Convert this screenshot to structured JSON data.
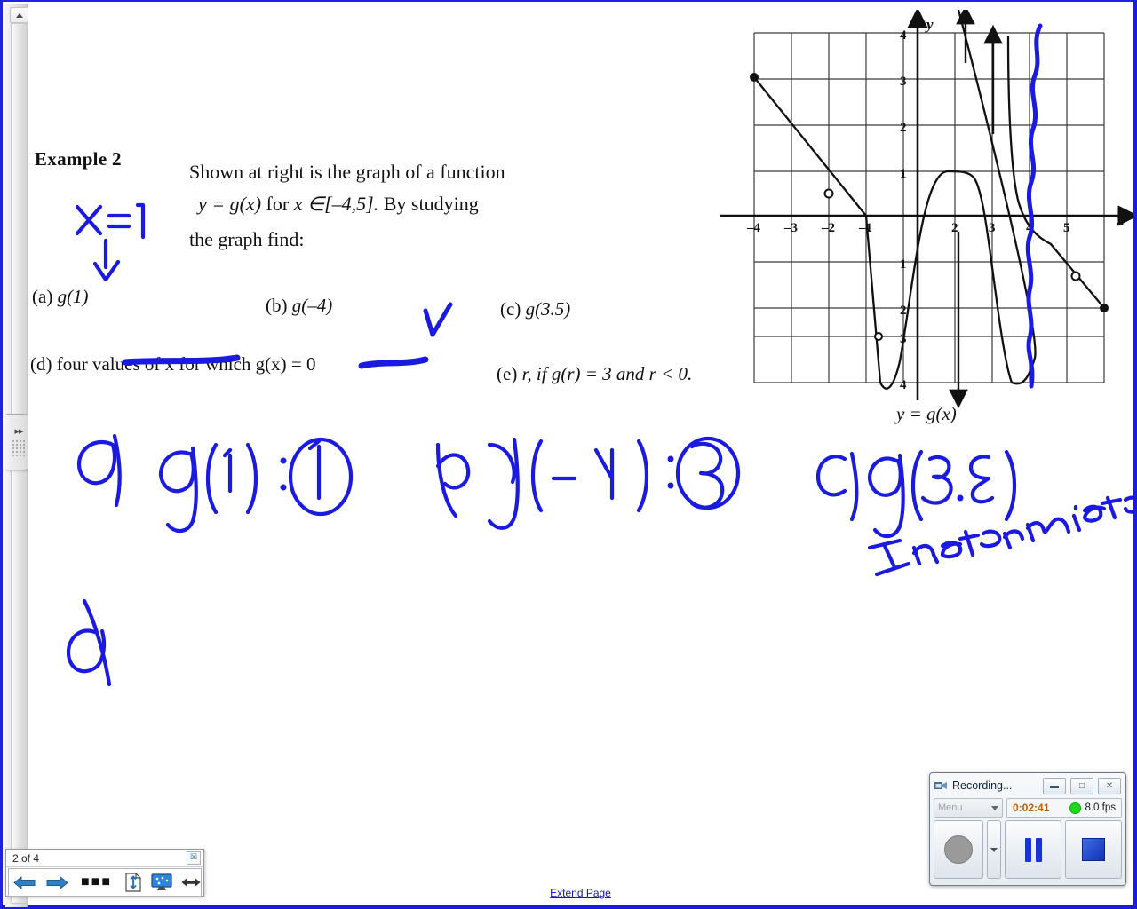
{
  "worksheet": {
    "example_label": "Example 2",
    "stem_line1": "Shown at right is the graph of a function",
    "stem_line2_a": "y = g(x)",
    "stem_line2_b": "for",
    "stem_line2_c": "x ∈[–4,5].",
    "stem_line2_d": "By studying",
    "stem_line3": "the graph find:",
    "questions": [
      {
        "tag": "(a)",
        "text": "g(1)"
      },
      {
        "tag": "(b)",
        "text": "g(–4)"
      },
      {
        "tag": "(c)",
        "text": "g(3.5)"
      },
      {
        "tag": "(d)",
        "text": "four values of x for which g(x) = 0"
      },
      {
        "tag": "(e)",
        "text": "r, if g(r) = 3 and r < 0."
      }
    ],
    "figure_caption": "y = g(x)"
  },
  "handwriting": {
    "ink_color": "#1a1ae0",
    "annotation_x_equals": "x=1",
    "answer_a": "a)  g(1) :",
    "answer_a_circled": "1",
    "answer_b": "b)  g(-4) :",
    "answer_b_circled": "3",
    "answer_c": "c)  g(3.5)",
    "answer_c_note": "Indeterminate",
    "answer_d": "d)"
  },
  "chart_data": {
    "type": "line",
    "title": "y = g(x)",
    "xlabel": "x",
    "ylabel": "y",
    "xlim": [
      -4.6,
      5.4
    ],
    "ylim": [
      -4.4,
      4.4
    ],
    "xticks": [
      -4,
      -3,
      -2,
      -1,
      2,
      3,
      4,
      5
    ],
    "yticks": [
      4,
      3,
      2,
      1,
      -1,
      -2,
      -3,
      -4
    ],
    "grid": true,
    "legend": "none",
    "series": [
      {
        "name": "segment-1 (falling line from (-4,3) to (-1,0))",
        "points": [
          [
            -4,
            3
          ],
          [
            -1,
            0
          ]
        ]
      },
      {
        "name": "segment-2 (steep fall to minimum)",
        "points": [
          [
            -1,
            0
          ],
          [
            -1.25,
            -4
          ]
        ]
      },
      {
        "name": "segment-3 (rise to plateau near y=1)",
        "points": [
          [
            -1.25,
            -4
          ],
          [
            -0.9,
            -2.0
          ],
          [
            -0.55,
            0
          ],
          [
            -0.3,
            1
          ],
          [
            0.35,
            1
          ],
          [
            0.6,
            0
          ],
          [
            0.85,
            -2
          ],
          [
            1.05,
            -4
          ]
        ]
      },
      {
        "name": "segment-4 (branch rising to +infinity near x=2.05)",
        "points": [
          [
            1.05,
            -4
          ],
          [
            1.6,
            -4
          ],
          [
            1.95,
            0
          ],
          [
            2.05,
            4
          ]
        ]
      },
      {
        "name": "segment-5 (branch from +infinity near x=2.45 to descent)",
        "points": [
          [
            2.45,
            4
          ],
          [
            2.6,
            0
          ],
          [
            2.8,
            -0.7
          ],
          [
            3.2,
            -1.05
          ]
        ]
      },
      {
        "name": "segment-6 (final falling line to (5,-2))",
        "points": [
          [
            3.2,
            -1.05
          ],
          [
            3.7,
            -1.5
          ],
          [
            5,
            -2
          ]
        ]
      }
    ],
    "closed_points": [
      [
        -4,
        3
      ],
      [
        5,
        -2
      ]
    ],
    "open_points": [
      [
        -2,
        0.5
      ],
      [
        -1.05,
        -3
      ],
      [
        3.7,
        -1.5
      ]
    ],
    "asymptote_arrows": [
      {
        "x": 1.1,
        "direction": "down",
        "to": -4
      },
      {
        "x": 2.05,
        "direction": "up",
        "to": 4
      },
      {
        "x": 2.4,
        "direction": "up",
        "to": 4
      }
    ]
  },
  "page_nav": {
    "counter": "2 of 4",
    "close_glyph": "☒",
    "buttons": [
      {
        "name": "previous-page",
        "icon": "left-arrow-icon"
      },
      {
        "name": "next-page",
        "icon": "right-arrow-icon"
      },
      {
        "name": "more-options",
        "icon": "ellipsis-icon"
      },
      {
        "name": "fit-page-height",
        "icon": "page-height-icon"
      },
      {
        "name": "presentation-mode",
        "icon": "monitor-icon"
      },
      {
        "name": "fit-page-width",
        "icon": "width-arrow-icon"
      }
    ]
  },
  "links": {
    "extend_page": "Extend Page"
  },
  "recorder": {
    "title": "Recording...",
    "minimize_glyph": "▬",
    "restore_glyph": "□",
    "close_glyph": "✕",
    "menu_label": "Menu",
    "elapsed": "0:02:41",
    "fps": "8.0 fps",
    "led_color": "#19dd19",
    "buttons": [
      {
        "name": "record-button",
        "icon": "record-circle-icon"
      },
      {
        "name": "record-options-button",
        "icon": "chevron-down-icon"
      },
      {
        "name": "pause-button",
        "icon": "pause-bars-icon"
      },
      {
        "name": "stop-button",
        "icon": "stop-square-icon"
      }
    ]
  }
}
